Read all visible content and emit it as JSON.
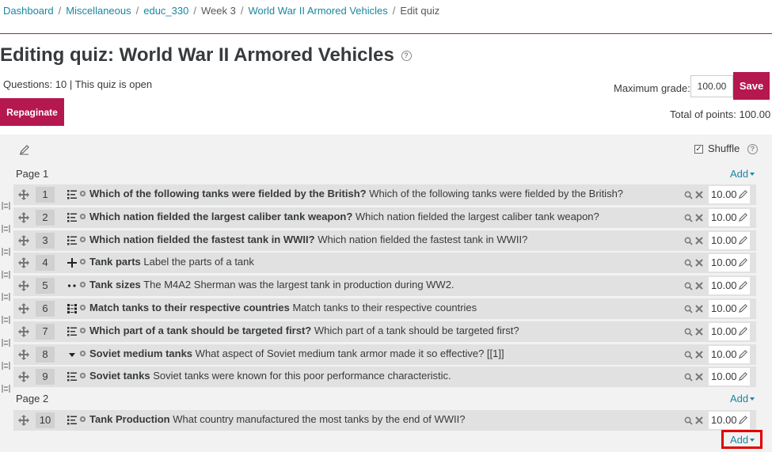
{
  "breadcrumb": {
    "items": [
      {
        "label": "Dashboard",
        "link": true
      },
      {
        "label": "Miscellaneous",
        "link": true
      },
      {
        "label": "educ_330",
        "link": true
      },
      {
        "label": "Week 3",
        "link": false
      },
      {
        "label": "World War II Armored Vehicles",
        "link": true
      },
      {
        "label": "Edit quiz",
        "link": false
      }
    ],
    "separator": "/"
  },
  "header": {
    "title": "Editing quiz: World War II Armored Vehicles",
    "help_glyph": "?",
    "quiz_info": "Questions: 10 | This quiz is open"
  },
  "grade": {
    "max_label": "Maximum grade:",
    "max_value": "100.00",
    "save_label": "Save",
    "total_label": "Total of points: 100.00"
  },
  "toolbar": {
    "repaginate_label": "Repaginate",
    "shuffle_label": "Shuffle",
    "shuffle_checked": true
  },
  "add_label": "Add",
  "pages": [
    {
      "label": "Page 1"
    },
    {
      "label": "Page 2"
    }
  ],
  "questions": [
    {
      "slot": "1",
      "icon": "multichoice-icon",
      "name": "Which of the following tanks were fielded by the British?",
      "text": "Which of the following tanks were fielded by the British?",
      "mark": "10.00"
    },
    {
      "slot": "2",
      "icon": "multichoice-icon",
      "name": "Which nation fielded the largest caliber tank weapon?",
      "text": "Which nation fielded the largest caliber tank weapon?",
      "mark": "10.00"
    },
    {
      "slot": "3",
      "icon": "multichoice-icon",
      "name": "Which nation fielded the fastest tank in WWII?",
      "text": "Which nation fielded the fastest tank in WWII?",
      "mark": "10.00"
    },
    {
      "slot": "4",
      "icon": "drag-drop-markers-icon",
      "name": "Tank parts",
      "text": "Label the parts of a tank",
      "mark": "10.00"
    },
    {
      "slot": "5",
      "icon": "true-false-icon",
      "name": "Tank sizes",
      "text": "The M4A2 Sherman was the largest tank in production during WW2.",
      "mark": "10.00"
    },
    {
      "slot": "6",
      "icon": "matching-icon",
      "name": "Match tanks to their respective countries",
      "text": "Match tanks to their respective countries",
      "mark": "10.00"
    },
    {
      "slot": "7",
      "icon": "multichoice-icon",
      "name": "Which part of a tank should be targeted first?",
      "text": "Which part of a tank should be targeted first?",
      "mark": "10.00"
    },
    {
      "slot": "8",
      "icon": "select-missing-words-icon",
      "name": "Soviet medium tanks",
      "text": "What aspect of Soviet medium tank armor made it so effective? [[1]]",
      "mark": "10.00"
    },
    {
      "slot": "9",
      "icon": "multichoice-icon",
      "name": "Soviet tanks",
      "text": "Soviet tanks were known for this poor performance characteristic.",
      "mark": "10.00"
    },
    {
      "slot": "10",
      "icon": "multichoice-icon",
      "name": "Tank Production",
      "text": "What country manufactured the most tanks by the end of WWII?",
      "mark": "10.00"
    }
  ],
  "colors": {
    "brand": "#b5174f",
    "link": "#1a87a0",
    "highlight": "#e00000"
  }
}
